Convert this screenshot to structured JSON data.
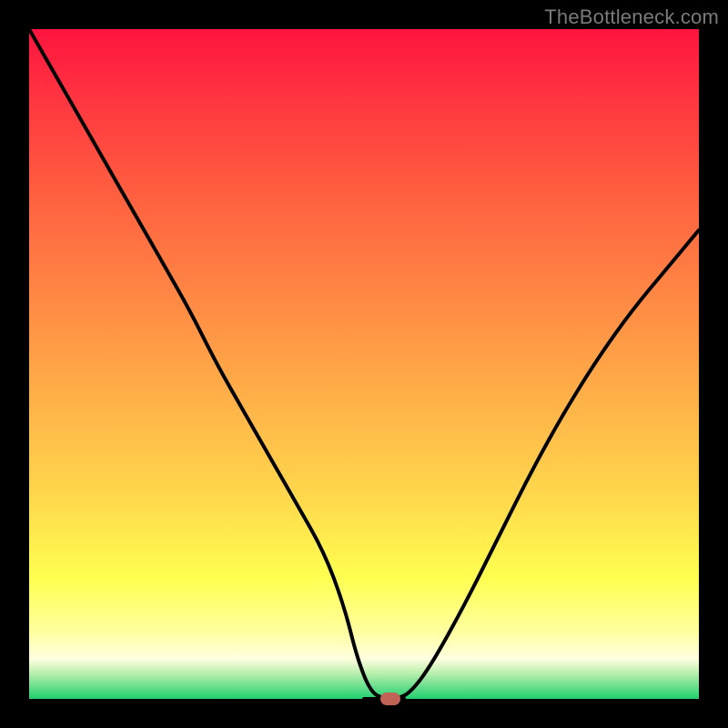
{
  "attribution": "TheBottleneck.com",
  "colors": {
    "frame": "#000000",
    "gradient_top": "#ff1440",
    "gradient_bottom": "#20d070",
    "curve": "#000000",
    "marker": "#c16257"
  },
  "chart_data": {
    "type": "line",
    "title": "",
    "xlabel": "",
    "ylabel": "",
    "xlim": [
      0,
      100
    ],
    "ylim": [
      0,
      100
    ],
    "grid": false,
    "series": [
      {
        "name": "bottleneck-curve",
        "x": [
          0,
          4,
          8,
          12,
          16,
          20,
          24,
          28,
          32,
          36,
          40,
          44,
          47,
          49,
          51,
          53,
          55,
          57,
          60,
          65,
          70,
          75,
          80,
          85,
          90,
          95,
          100
        ],
        "values": [
          100,
          93,
          86,
          79,
          72,
          65,
          58,
          50,
          43,
          36,
          29,
          22,
          14,
          6,
          1,
          0,
          0,
          1,
          5,
          14,
          24,
          34,
          43,
          51,
          58,
          64,
          70
        ]
      }
    ],
    "marker": {
      "x": 54,
      "y": 0
    },
    "flat_segment": {
      "x0": 50,
      "x1": 56,
      "y": 0
    }
  }
}
